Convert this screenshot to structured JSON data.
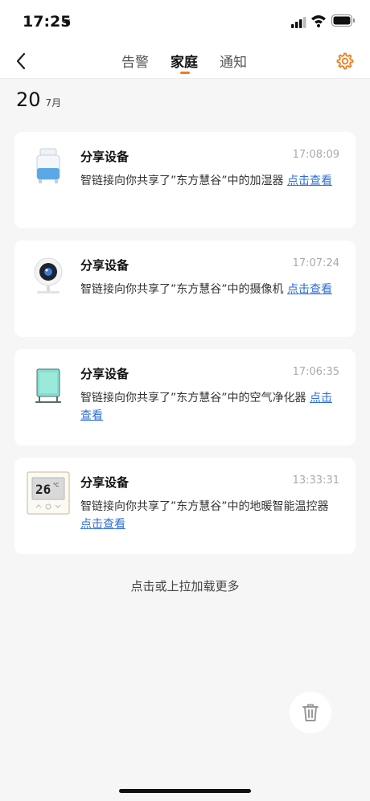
{
  "status_bar": {
    "time": "17:25"
  },
  "nav": {
    "tabs": [
      {
        "label": "告警"
      },
      {
        "label": "家庭"
      },
      {
        "label": "通知"
      }
    ],
    "active_tab": "家庭",
    "accent_color": "#f07d1e"
  },
  "date": {
    "day": "20",
    "month": "7月"
  },
  "notifications": [
    {
      "title": "分享设备",
      "time": "17:08:09",
      "message": "智链接向你共享了”东方慧谷”中的加湿器 ",
      "link": "点击查看",
      "device_icon": "humidifier-icon"
    },
    {
      "title": "分享设备",
      "time": "17:07:24",
      "message": "智链接向你共享了”东方慧谷”中的摄像机 ",
      "link": "点击查看",
      "device_icon": "camera-icon"
    },
    {
      "title": "分享设备",
      "time": "17:06:35",
      "message": "智链接向你共享了”东方慧谷”中的空气净化器 ",
      "link": "点击查看",
      "device_icon": "air-purifier-icon"
    },
    {
      "title": "分享设备",
      "time": "13:33:31",
      "message": "智链接向你共享了”东方慧谷”中的地暖智能温控器 ",
      "link": "点击查看",
      "device_icon": "thermostat-icon",
      "thermostat_display": "26"
    }
  ],
  "load_more": "点击或上拉加载更多",
  "link_color": "#2f6fd6"
}
